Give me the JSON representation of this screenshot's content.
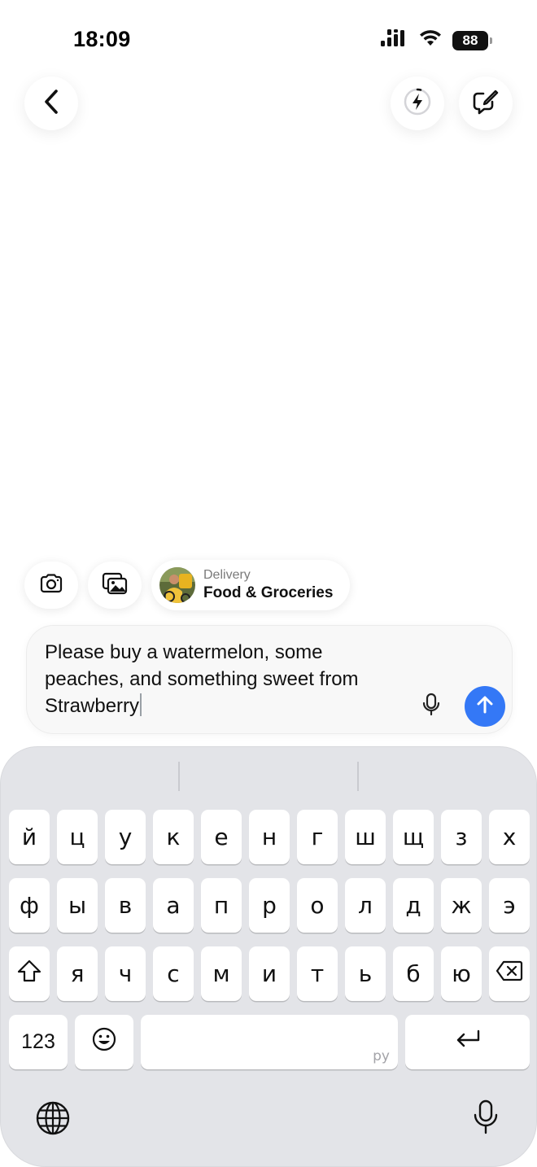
{
  "status_bar": {
    "time": "18:09",
    "battery": "88"
  },
  "header": {
    "back_icon": "chevron-left-icon",
    "flash_icon": "lightning-bolt-icon",
    "new_chat_icon": "compose-icon"
  },
  "quick_actions": {
    "camera_icon": "camera-icon",
    "gallery_icon": "photo-gallery-icon",
    "delivery": {
      "subtitle": "Delivery",
      "title": "Food & Groceries"
    }
  },
  "composer": {
    "text": "Please buy a watermelon, some peaches, and something sweet from Strawberry",
    "mic_icon": "microphone-icon",
    "send_icon": "arrow-up-icon",
    "accent": "#3478f6"
  },
  "keyboard": {
    "row1": [
      "й",
      "ц",
      "у",
      "к",
      "е",
      "н",
      "г",
      "ш",
      "щ",
      "з",
      "х"
    ],
    "row2": [
      "ф",
      "ы",
      "в",
      "а",
      "п",
      "р",
      "о",
      "л",
      "д",
      "ж",
      "э"
    ],
    "row3": [
      "я",
      "ч",
      "с",
      "м",
      "и",
      "т",
      "ь",
      "б",
      "ю"
    ],
    "numbers_label": "123",
    "space_hint": "ру",
    "globe_icon": "globe-icon",
    "dictation_icon": "microphone-icon"
  }
}
